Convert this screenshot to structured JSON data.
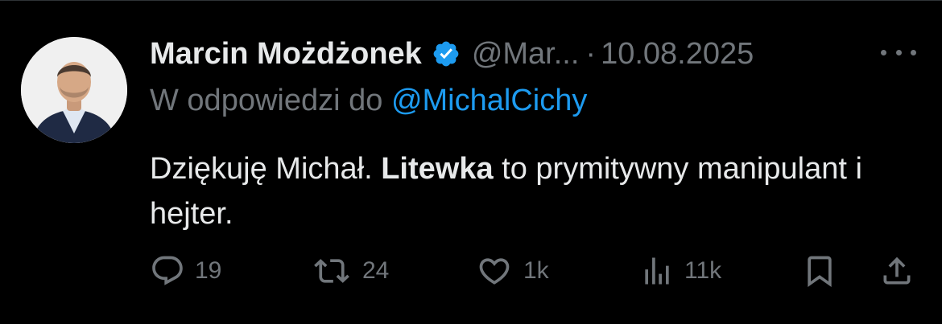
{
  "tweet": {
    "author_name": "Marcin Możdżonek",
    "handle": "@Mar...",
    "separator": "·",
    "date": "10.08.2025",
    "reply_prefix": "W odpowiedzi do",
    "reply_mention": "@MichalCichy",
    "text_before": "Dziękuję Michał. ",
    "text_bold": "Litewka",
    "text_after": " to prymitywny manipulant i hejter."
  },
  "actions": {
    "replies": "19",
    "reposts": "24",
    "likes": "1k",
    "views": "11k"
  },
  "icons": {
    "verified": "verified-badge-icon",
    "more": "more-options-icon",
    "reply": "reply-icon",
    "repost": "repost-icon",
    "like": "like-icon",
    "views": "views-icon",
    "bookmark": "bookmark-icon",
    "share": "share-icon"
  },
  "colors": {
    "background": "#000000",
    "text": "#e7e9ea",
    "muted": "#71767b",
    "accent": "#1d9bf0"
  }
}
